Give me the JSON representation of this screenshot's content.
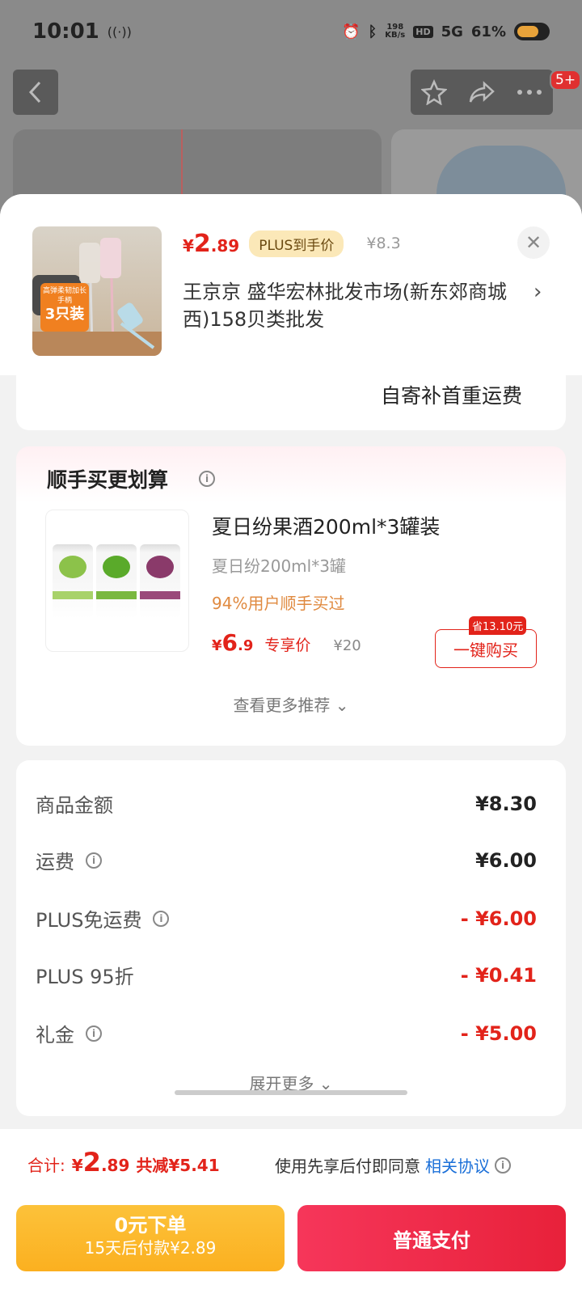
{
  "status": {
    "time": "10:01",
    "speed_value": "198",
    "speed_unit": "KB/s",
    "hd": "HD",
    "net": "5G",
    "battery": "61%"
  },
  "nav": {
    "badge": "5+"
  },
  "product": {
    "price_symbol": "¥",
    "price_int": "2",
    "price_dec": ".89",
    "plus_tag": "PLUS到手价",
    "orig_price": "¥8.3",
    "address": "王京京  盛华宏林批发市场(新东郊商城西)158贝类批发",
    "thumb_text1": "高弹柔韧加长手柄",
    "thumb_count": "3只装"
  },
  "shipping_note": "自寄补首重运费",
  "recommend": {
    "title": "顺手买更划算",
    "item_name": "夏日纷果酒200ml*3罐装",
    "item_spec": "夏日纷200ml*3罐",
    "item_stat": "94%用户顺手买过",
    "price_symbol": "¥",
    "price_int": "6",
    "price_dec": ".9",
    "exclusive": "专享价",
    "orig_price": "¥20",
    "save_badge": "省13.10元",
    "buy_label": "一键购买",
    "more_label": "查看更多推荐 ⌄"
  },
  "fees": [
    {
      "label": "商品金额",
      "value": "¥8.30",
      "info": false,
      "red": false
    },
    {
      "label": "运费",
      "value": "¥6.00",
      "info": true,
      "red": false
    },
    {
      "label": "PLUS免运费",
      "value": "- ¥6.00",
      "info": true,
      "red": true
    },
    {
      "label": "PLUS 95折",
      "value": "- ¥0.41",
      "info": false,
      "red": true
    },
    {
      "label": "礼金",
      "value": "- ¥5.00",
      "info": true,
      "red": true
    }
  ],
  "expand_label": "展开更多 ⌄",
  "bottom": {
    "total_label": "合计:",
    "total_symbol": "¥",
    "total_int": "2",
    "total_dec": ".89",
    "total_save": "共减¥5.41",
    "agree_text": "使用先享后付即同意",
    "agree_link": "相关协议",
    "btn_later_main": "0元下单",
    "btn_later_sub": "15天后付款¥2.89",
    "btn_pay": "普通支付"
  },
  "colors": {
    "accent_red": "#e2231a",
    "link_blue": "#1a6fd8",
    "pay_later_yellow": "#fbb020"
  }
}
